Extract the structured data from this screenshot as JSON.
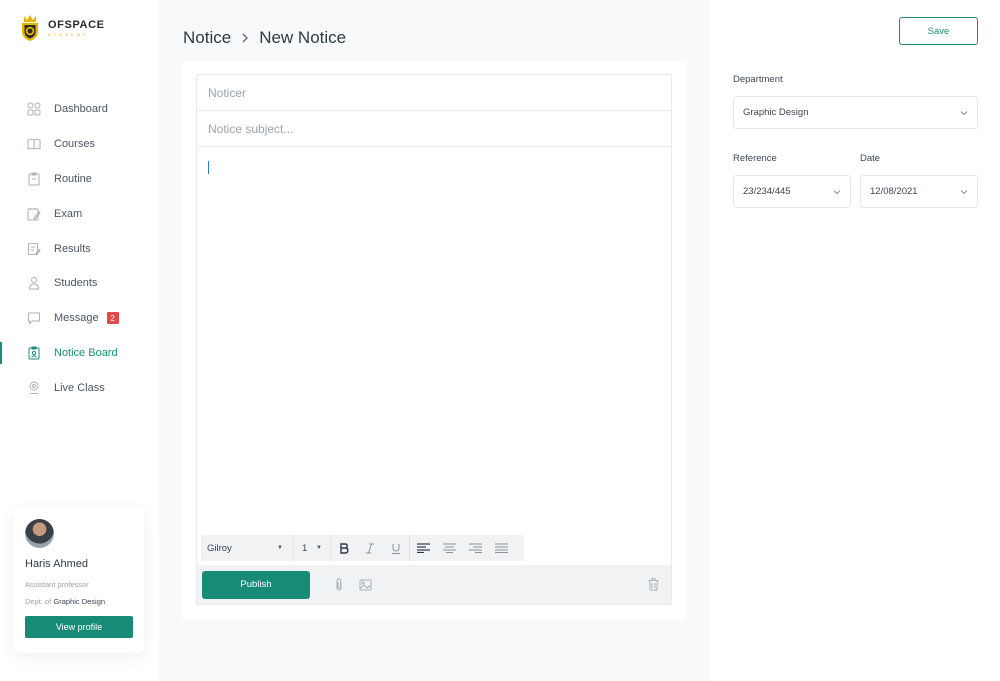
{
  "brand": {
    "name": "OFSPACE",
    "sub": "ACADEMY"
  },
  "sidebar": {
    "items": [
      {
        "label": "Dashboard",
        "icon": "dashboard-icon"
      },
      {
        "label": "Courses",
        "icon": "book-icon"
      },
      {
        "label": "Routine",
        "icon": "clipboard-icon"
      },
      {
        "label": "Exam",
        "icon": "exam-icon"
      },
      {
        "label": "Results",
        "icon": "results-icon"
      },
      {
        "label": "Students",
        "icon": "student-icon"
      },
      {
        "label": "Message",
        "icon": "message-icon",
        "badge": "2"
      },
      {
        "label": "Notice Board",
        "icon": "notice-icon",
        "active": true
      },
      {
        "label": "Live Class",
        "icon": "live-icon"
      }
    ]
  },
  "profile": {
    "name": "Haris Ahmed",
    "role": "Assistant professor",
    "dept_prefix": "Dept. of",
    "dept": "Graphic Design",
    "button": "View profile"
  },
  "breadcrumb": {
    "parent": "Notice",
    "current": "New Notice"
  },
  "editor": {
    "noticer_placeholder": "Noticer",
    "subject_placeholder": "Notice subject...",
    "font": "Gilroy",
    "size": "1",
    "publish_label": "Publish"
  },
  "right": {
    "save_label": "Save",
    "department_label": "Department",
    "department_value": "Graphic Design",
    "reference_label": "Reference",
    "reference_value": "23/234/445",
    "date_label": "Date",
    "date_value": "12/08/2021"
  },
  "colors": {
    "accent": "#178b76",
    "badge": "#e04b4b",
    "logo_yellow": "#e8b400"
  }
}
